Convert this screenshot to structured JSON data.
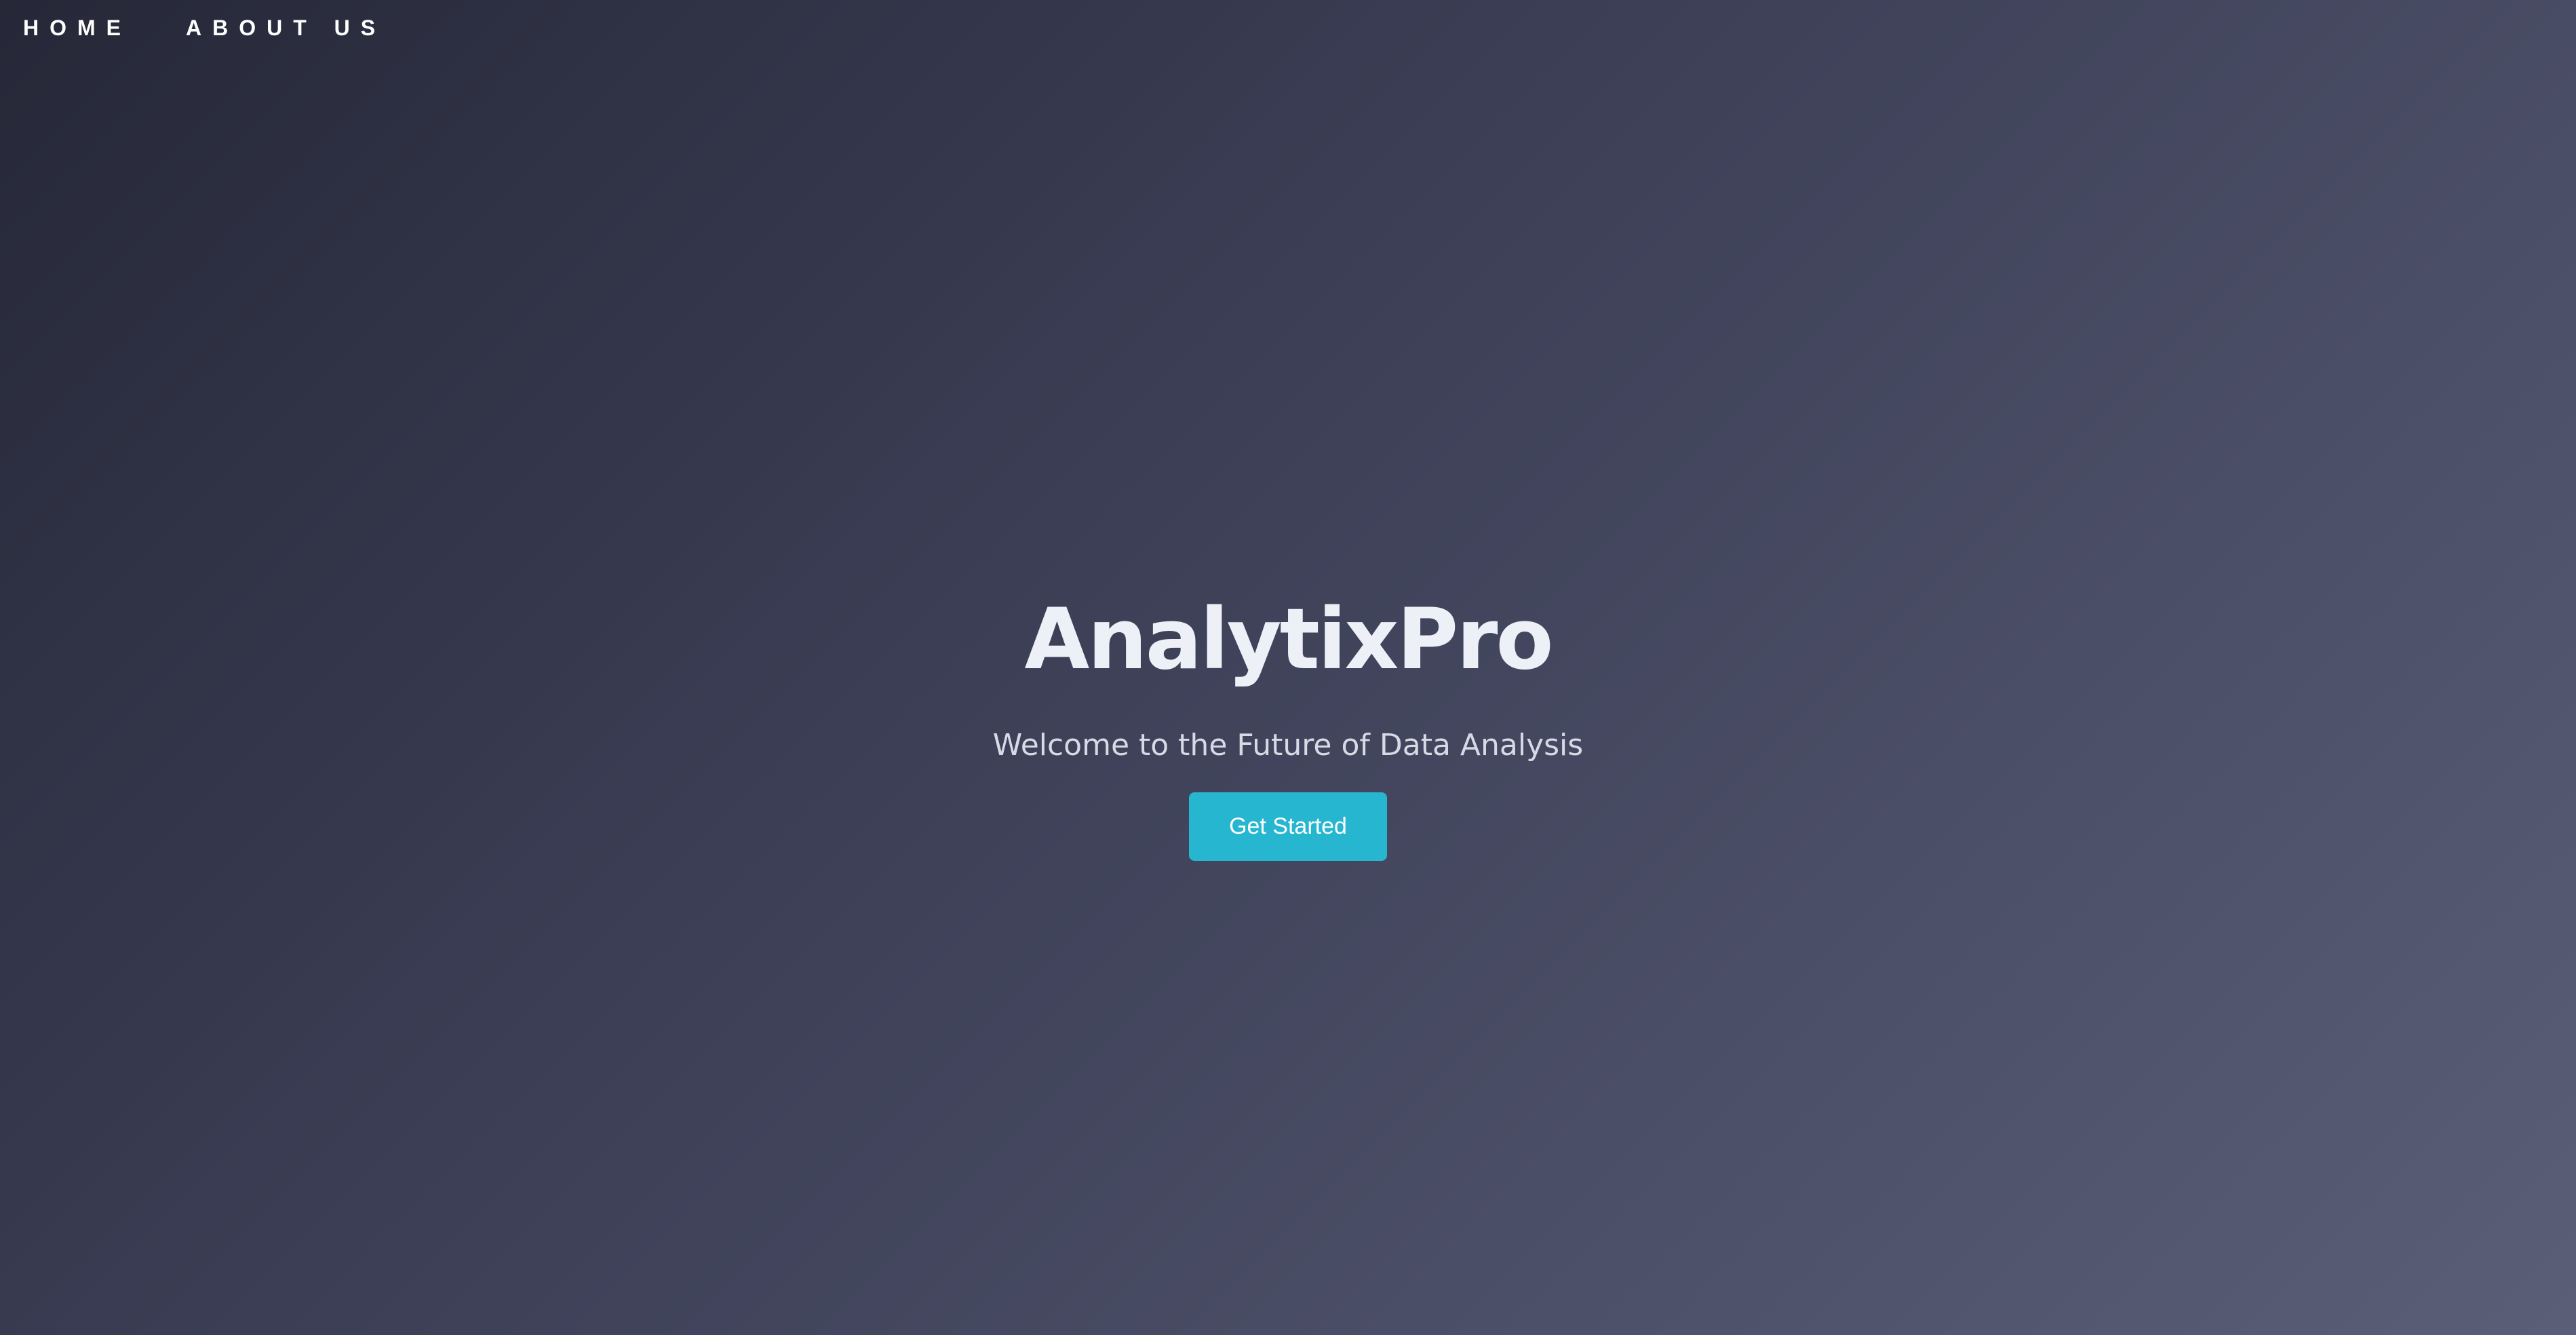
{
  "nav": {
    "items": [
      {
        "label": "HOME"
      },
      {
        "label": "ABOUT US"
      }
    ]
  },
  "hero": {
    "title": "AnalytixPro",
    "subtitle": "Welcome to the Future of Data Analysis",
    "cta_label": "Get Started"
  },
  "colors": {
    "background_start": "#262838",
    "background_end": "#5a5e76",
    "accent": "#27b6d0",
    "title_text": "#edf0f6",
    "subtitle_text": "#d7dae5"
  }
}
